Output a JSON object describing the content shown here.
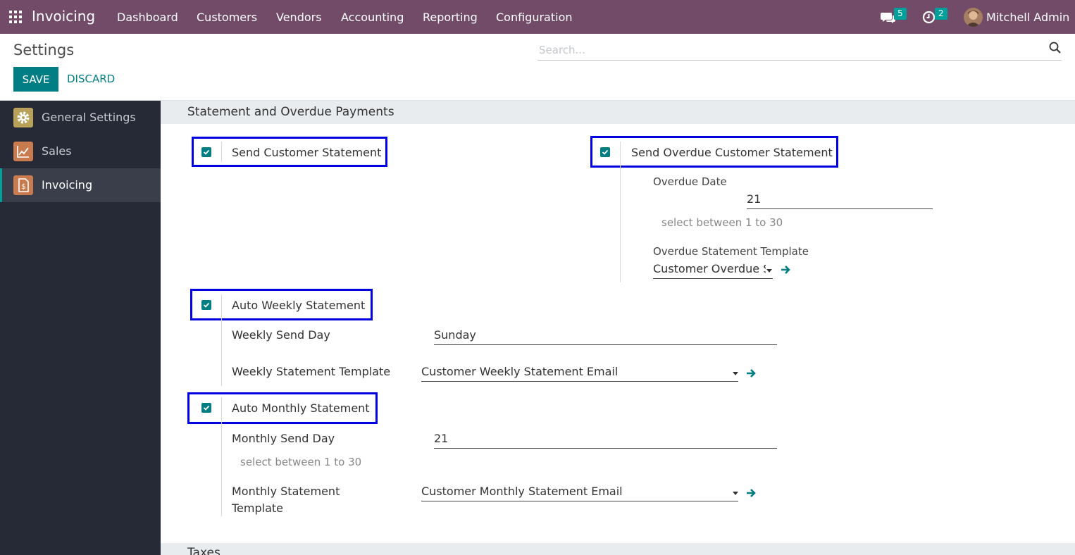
{
  "navbar": {
    "app_name": "Invoicing",
    "menu": [
      "Dashboard",
      "Customers",
      "Vendors",
      "Accounting",
      "Reporting",
      "Configuration"
    ],
    "messages_count": "5",
    "activities_count": "2",
    "user_name": "Mitchell Admin",
    "icons": [
      "apps-grid-icon",
      "chat-icon",
      "clock-icon"
    ]
  },
  "control": {
    "title": "Settings",
    "save_label": "SAVE",
    "discard_label": "DISCARD",
    "search_placeholder": "Search..."
  },
  "sidebar": {
    "items": [
      {
        "label": "General Settings",
        "icon": "gear-icon",
        "color": "#b8a25a"
      },
      {
        "label": "Sales",
        "icon": "chart-icon",
        "color": "#c87b4e"
      },
      {
        "label": "Invoicing",
        "icon": "invoice-icon",
        "color": "#c87b4e",
        "active": true
      }
    ]
  },
  "section": {
    "title": "Statement and Overdue Payments",
    "next_title": "Taxes"
  },
  "settings": {
    "send_customer_statement": {
      "label": "Send Customer Statement",
      "checked": true
    },
    "send_overdue": {
      "label": "Send Overdue Customer Statement",
      "checked": true,
      "overdue_date_label": "Overdue Date",
      "overdue_date_value": "21",
      "overdue_date_help": "select between 1 to 30",
      "template_label": "Overdue Statement Template",
      "template_value": "Customer Overdue Statement Email"
    },
    "auto_weekly": {
      "label": "Auto Weekly Statement",
      "checked": true,
      "send_day_label": "Weekly Send Day",
      "send_day_value": "Sunday",
      "template_label": "Weekly Statement Template",
      "template_value": "Customer Weekly Statement Email"
    },
    "auto_monthly": {
      "label": "Auto Monthly Statement",
      "checked": true,
      "send_day_label": "Monthly Send Day",
      "send_day_value": "21",
      "send_day_help": "select between 1 to 30",
      "template_label_line1": "Monthly Statement",
      "template_label_line2": "Template",
      "template_value": "Customer Monthly Statement Email"
    }
  },
  "colors": {
    "navbar": "#714b67",
    "primary": "#017e84",
    "badge": "#00a09d",
    "highlight": "#0000e0",
    "sidebar": "#262a36"
  }
}
